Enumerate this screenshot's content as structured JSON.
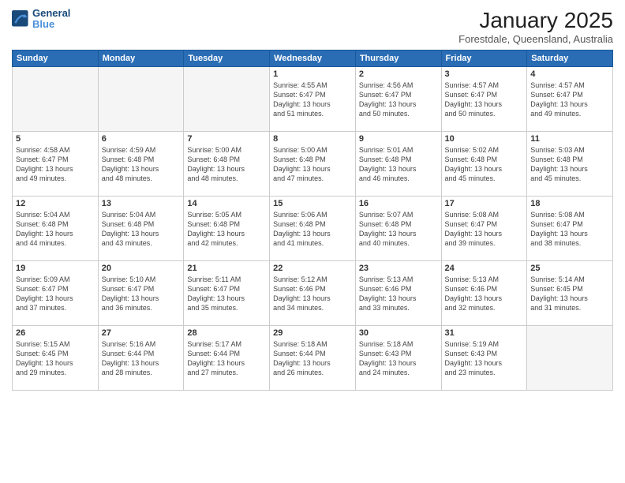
{
  "header": {
    "logo_line1": "General",
    "logo_line2": "Blue",
    "month_year": "January 2025",
    "location": "Forestdale, Queensland, Australia"
  },
  "weekdays": [
    "Sunday",
    "Monday",
    "Tuesday",
    "Wednesday",
    "Thursday",
    "Friday",
    "Saturday"
  ],
  "weeks": [
    [
      {
        "day": "",
        "text": ""
      },
      {
        "day": "",
        "text": ""
      },
      {
        "day": "",
        "text": ""
      },
      {
        "day": "1",
        "text": "Sunrise: 4:55 AM\nSunset: 6:47 PM\nDaylight: 13 hours\nand 51 minutes."
      },
      {
        "day": "2",
        "text": "Sunrise: 4:56 AM\nSunset: 6:47 PM\nDaylight: 13 hours\nand 50 minutes."
      },
      {
        "day": "3",
        "text": "Sunrise: 4:57 AM\nSunset: 6:47 PM\nDaylight: 13 hours\nand 50 minutes."
      },
      {
        "day": "4",
        "text": "Sunrise: 4:57 AM\nSunset: 6:47 PM\nDaylight: 13 hours\nand 49 minutes."
      }
    ],
    [
      {
        "day": "5",
        "text": "Sunrise: 4:58 AM\nSunset: 6:47 PM\nDaylight: 13 hours\nand 49 minutes."
      },
      {
        "day": "6",
        "text": "Sunrise: 4:59 AM\nSunset: 6:48 PM\nDaylight: 13 hours\nand 48 minutes."
      },
      {
        "day": "7",
        "text": "Sunrise: 5:00 AM\nSunset: 6:48 PM\nDaylight: 13 hours\nand 48 minutes."
      },
      {
        "day": "8",
        "text": "Sunrise: 5:00 AM\nSunset: 6:48 PM\nDaylight: 13 hours\nand 47 minutes."
      },
      {
        "day": "9",
        "text": "Sunrise: 5:01 AM\nSunset: 6:48 PM\nDaylight: 13 hours\nand 46 minutes."
      },
      {
        "day": "10",
        "text": "Sunrise: 5:02 AM\nSunset: 6:48 PM\nDaylight: 13 hours\nand 45 minutes."
      },
      {
        "day": "11",
        "text": "Sunrise: 5:03 AM\nSunset: 6:48 PM\nDaylight: 13 hours\nand 45 minutes."
      }
    ],
    [
      {
        "day": "12",
        "text": "Sunrise: 5:04 AM\nSunset: 6:48 PM\nDaylight: 13 hours\nand 44 minutes."
      },
      {
        "day": "13",
        "text": "Sunrise: 5:04 AM\nSunset: 6:48 PM\nDaylight: 13 hours\nand 43 minutes."
      },
      {
        "day": "14",
        "text": "Sunrise: 5:05 AM\nSunset: 6:48 PM\nDaylight: 13 hours\nand 42 minutes."
      },
      {
        "day": "15",
        "text": "Sunrise: 5:06 AM\nSunset: 6:48 PM\nDaylight: 13 hours\nand 41 minutes."
      },
      {
        "day": "16",
        "text": "Sunrise: 5:07 AM\nSunset: 6:48 PM\nDaylight: 13 hours\nand 40 minutes."
      },
      {
        "day": "17",
        "text": "Sunrise: 5:08 AM\nSunset: 6:47 PM\nDaylight: 13 hours\nand 39 minutes."
      },
      {
        "day": "18",
        "text": "Sunrise: 5:08 AM\nSunset: 6:47 PM\nDaylight: 13 hours\nand 38 minutes."
      }
    ],
    [
      {
        "day": "19",
        "text": "Sunrise: 5:09 AM\nSunset: 6:47 PM\nDaylight: 13 hours\nand 37 minutes."
      },
      {
        "day": "20",
        "text": "Sunrise: 5:10 AM\nSunset: 6:47 PM\nDaylight: 13 hours\nand 36 minutes."
      },
      {
        "day": "21",
        "text": "Sunrise: 5:11 AM\nSunset: 6:47 PM\nDaylight: 13 hours\nand 35 minutes."
      },
      {
        "day": "22",
        "text": "Sunrise: 5:12 AM\nSunset: 6:46 PM\nDaylight: 13 hours\nand 34 minutes."
      },
      {
        "day": "23",
        "text": "Sunrise: 5:13 AM\nSunset: 6:46 PM\nDaylight: 13 hours\nand 33 minutes."
      },
      {
        "day": "24",
        "text": "Sunrise: 5:13 AM\nSunset: 6:46 PM\nDaylight: 13 hours\nand 32 minutes."
      },
      {
        "day": "25",
        "text": "Sunrise: 5:14 AM\nSunset: 6:45 PM\nDaylight: 13 hours\nand 31 minutes."
      }
    ],
    [
      {
        "day": "26",
        "text": "Sunrise: 5:15 AM\nSunset: 6:45 PM\nDaylight: 13 hours\nand 29 minutes."
      },
      {
        "day": "27",
        "text": "Sunrise: 5:16 AM\nSunset: 6:44 PM\nDaylight: 13 hours\nand 28 minutes."
      },
      {
        "day": "28",
        "text": "Sunrise: 5:17 AM\nSunset: 6:44 PM\nDaylight: 13 hours\nand 27 minutes."
      },
      {
        "day": "29",
        "text": "Sunrise: 5:18 AM\nSunset: 6:44 PM\nDaylight: 13 hours\nand 26 minutes."
      },
      {
        "day": "30",
        "text": "Sunrise: 5:18 AM\nSunset: 6:43 PM\nDaylight: 13 hours\nand 24 minutes."
      },
      {
        "day": "31",
        "text": "Sunrise: 5:19 AM\nSunset: 6:43 PM\nDaylight: 13 hours\nand 23 minutes."
      },
      {
        "day": "",
        "text": ""
      }
    ]
  ]
}
